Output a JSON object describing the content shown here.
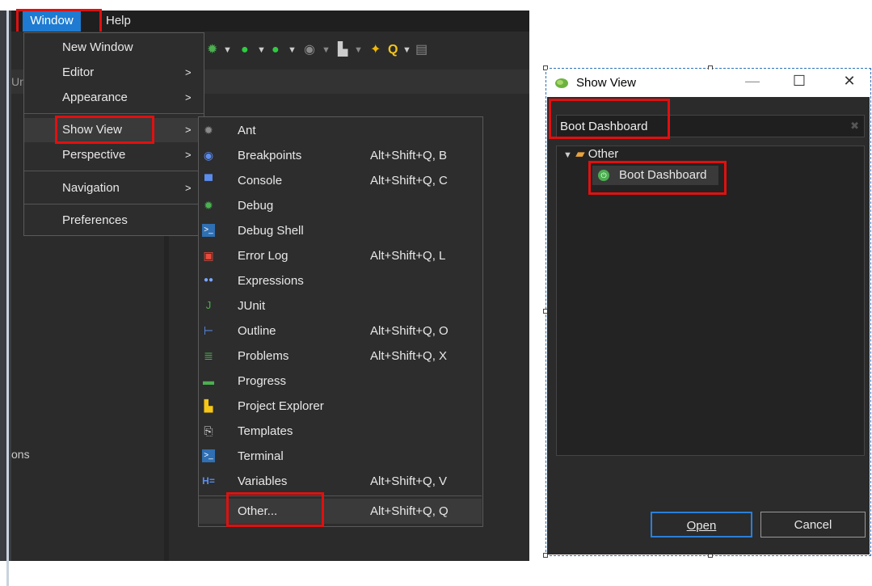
{
  "menubar": {
    "window_label": "Window",
    "help_label": "Help"
  },
  "ide": {
    "left_text_fragment": "Ur",
    "lower_left_fragment": "ons"
  },
  "window_menu": {
    "items": [
      {
        "label": "New Window",
        "has_submenu": false
      },
      {
        "label": "Editor",
        "has_submenu": true
      },
      {
        "label": "Appearance",
        "has_submenu": true
      },
      {
        "label": "Show View",
        "has_submenu": true
      },
      {
        "label": "Perspective",
        "has_submenu": true
      },
      {
        "label": "Navigation",
        "has_submenu": true
      },
      {
        "label": "Preferences",
        "has_submenu": false
      }
    ],
    "arrow": ">"
  },
  "show_view_menu": {
    "items": [
      {
        "label": "Ant",
        "shortcut": "",
        "icon": "ant-icon"
      },
      {
        "label": "Breakpoints",
        "shortcut": "Alt+Shift+Q, B",
        "icon": "breakpoints-icon"
      },
      {
        "label": "Console",
        "shortcut": "Alt+Shift+Q, C",
        "icon": "console-icon"
      },
      {
        "label": "Debug",
        "shortcut": "",
        "icon": "debug-icon"
      },
      {
        "label": "Debug Shell",
        "shortcut": "",
        "icon": "debug-shell-icon"
      },
      {
        "label": "Error Log",
        "shortcut": "Alt+Shift+Q, L",
        "icon": "error-log-icon"
      },
      {
        "label": "Expressions",
        "shortcut": "",
        "icon": "expressions-icon"
      },
      {
        "label": "JUnit",
        "shortcut": "",
        "icon": "junit-icon"
      },
      {
        "label": "Outline",
        "shortcut": "Alt+Shift+Q, O",
        "icon": "outline-icon"
      },
      {
        "label": "Problems",
        "shortcut": "Alt+Shift+Q, X",
        "icon": "problems-icon"
      },
      {
        "label": "Progress",
        "shortcut": "",
        "icon": "progress-icon"
      },
      {
        "label": "Project Explorer",
        "shortcut": "",
        "icon": "project-explorer-icon"
      },
      {
        "label": "Templates",
        "shortcut": "",
        "icon": "templates-icon"
      },
      {
        "label": "Terminal",
        "shortcut": "",
        "icon": "terminal-icon"
      },
      {
        "label": "Variables",
        "shortcut": "Alt+Shift+Q, V",
        "icon": "variables-icon"
      }
    ],
    "other": {
      "label": "Other...",
      "shortcut": "Alt+Shift+Q, Q"
    }
  },
  "dialog": {
    "title": "Show View",
    "search_value": "Boot Dashboard",
    "tree": {
      "category": "Other",
      "item": "Boot Dashboard"
    },
    "open_label": "Open",
    "cancel_label": "Cancel",
    "minimize_glyph": "—",
    "maximize_glyph": "☐",
    "close_glyph": "✕"
  },
  "colors": {
    "highlight": "#e01010",
    "selection": "#1e7bd1",
    "dark_bg": "#2b2b2b"
  }
}
